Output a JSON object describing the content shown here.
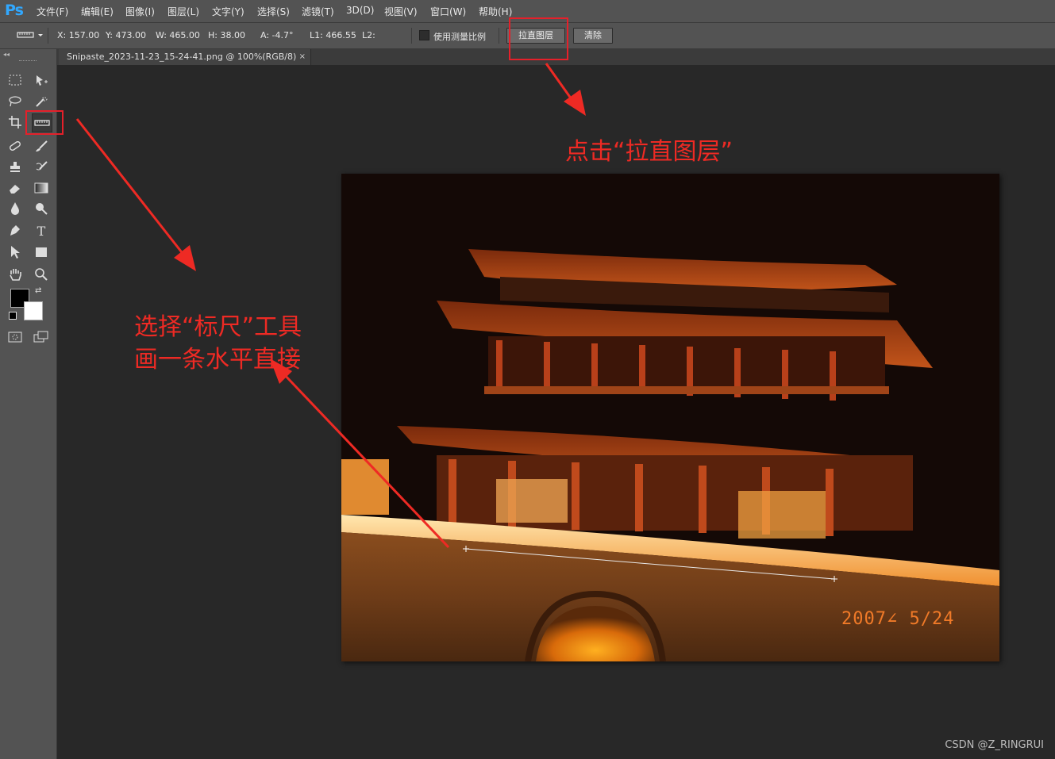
{
  "app": {
    "logo": "Ps"
  },
  "menu": [
    "文件(F)",
    "编辑(E)",
    "图像(I)",
    "图层(L)",
    "文字(Y)",
    "选择(S)",
    "滤镜(T)",
    "3D(D)",
    "视图(V)",
    "窗口(W)",
    "帮助(H)"
  ],
  "options": {
    "x": "X: 157.00",
    "y": "Y: 473.00",
    "w": "W: 465.00",
    "h": "H: 38.00",
    "a": "A: -4.7°",
    "l1": "L1: 466.55",
    "l2": "L2:",
    "use_scale_label": "使用测量比例",
    "straighten_label": "拉直图层",
    "clear_label": "清除"
  },
  "document": {
    "tab_title": "Snipaste_2023-11-23_15-24-41.png @ 100%(RGB/8)",
    "close_symbol": "×",
    "photo_date": "2007∠ 5∕24"
  },
  "annotations": {
    "click_straighten": "点击“拉直图层”",
    "select_ruler_line1": "选择“标尺”工具",
    "select_ruler_line2": "画一条水平直接"
  },
  "watermark": "CSDN @Z_RINGRUI",
  "colors": {
    "annotation_red": "#ee2a24",
    "ui_panel": "#535353",
    "workspace": "#282828"
  },
  "icons": [
    "marquee-icon",
    "move-icon",
    "lasso-icon",
    "quick-select-icon",
    "crop-icon",
    "ruler-icon",
    "healing-icon",
    "brush-icon",
    "stamp-icon",
    "history-brush-icon",
    "eraser-icon",
    "gradient-icon",
    "blur-icon",
    "dodge-icon",
    "pen-icon",
    "type-icon",
    "path-select-icon",
    "rectangle-icon",
    "hand-icon",
    "zoom-icon"
  ]
}
